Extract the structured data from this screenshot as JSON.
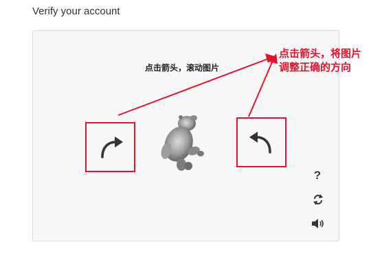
{
  "page": {
    "title": "Verify your account"
  },
  "captcha": {
    "instruction": "点击箭头，滚动图片",
    "image": "rotated-bear-image",
    "rotate_left_icon": "rotate-clockwise-arrow-icon",
    "rotate_right_icon": "rotate-counterclockwise-arrow-icon",
    "help_label": "?",
    "refresh_icon": "refresh-icon",
    "audio_icon": "speaker-icon"
  },
  "annotation": {
    "line1": "点击箭头，将图片",
    "line2": "调整正确的方向",
    "color": "#e8112d"
  }
}
